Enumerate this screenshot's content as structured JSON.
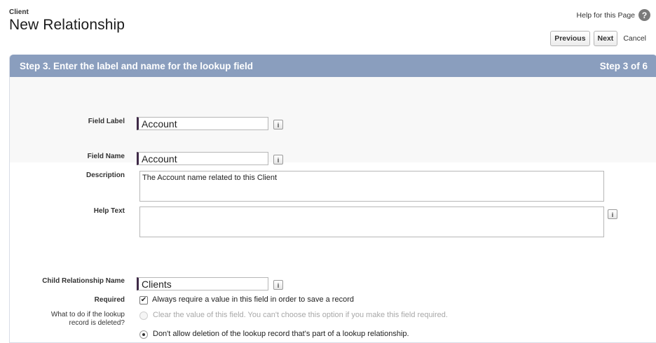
{
  "header": {
    "object_label": "Client",
    "page_title": "New Relationship",
    "help_link": "Help for this Page",
    "help_icon": "?"
  },
  "step": {
    "title": "Step 3. Enter the label and name for the lookup field",
    "counter": "Step 3 of 6"
  },
  "buttons": {
    "previous": "Previous",
    "next": "Next",
    "cancel": "Cancel"
  },
  "form": {
    "field_label": {
      "label": "Field Label",
      "value": "Account"
    },
    "field_name": {
      "label": "Field Name",
      "value": "Account"
    },
    "description": {
      "label": "Description",
      "value": "The Account name related to this Client"
    },
    "help_text": {
      "label": "Help Text",
      "value": ""
    },
    "child_relationship_name": {
      "label": "Child Relationship Name",
      "value": "Clients"
    },
    "required": {
      "label": "Required",
      "checked": true,
      "option_text": "Always require a value in this field in order to save a record"
    },
    "on_delete": {
      "label_line1": "What to do if the lookup",
      "label_line2": "record is deleted?",
      "options": [
        {
          "text": "Clear the value of this field. You can't choose this option if you make this field required.",
          "selected": false,
          "disabled": true
        },
        {
          "text": "Don't allow deletion of the lookup record that's part of a lookup relationship.",
          "selected": true,
          "disabled": false
        }
      ]
    },
    "info_icon": "i",
    "check_mark": "✔"
  }
}
